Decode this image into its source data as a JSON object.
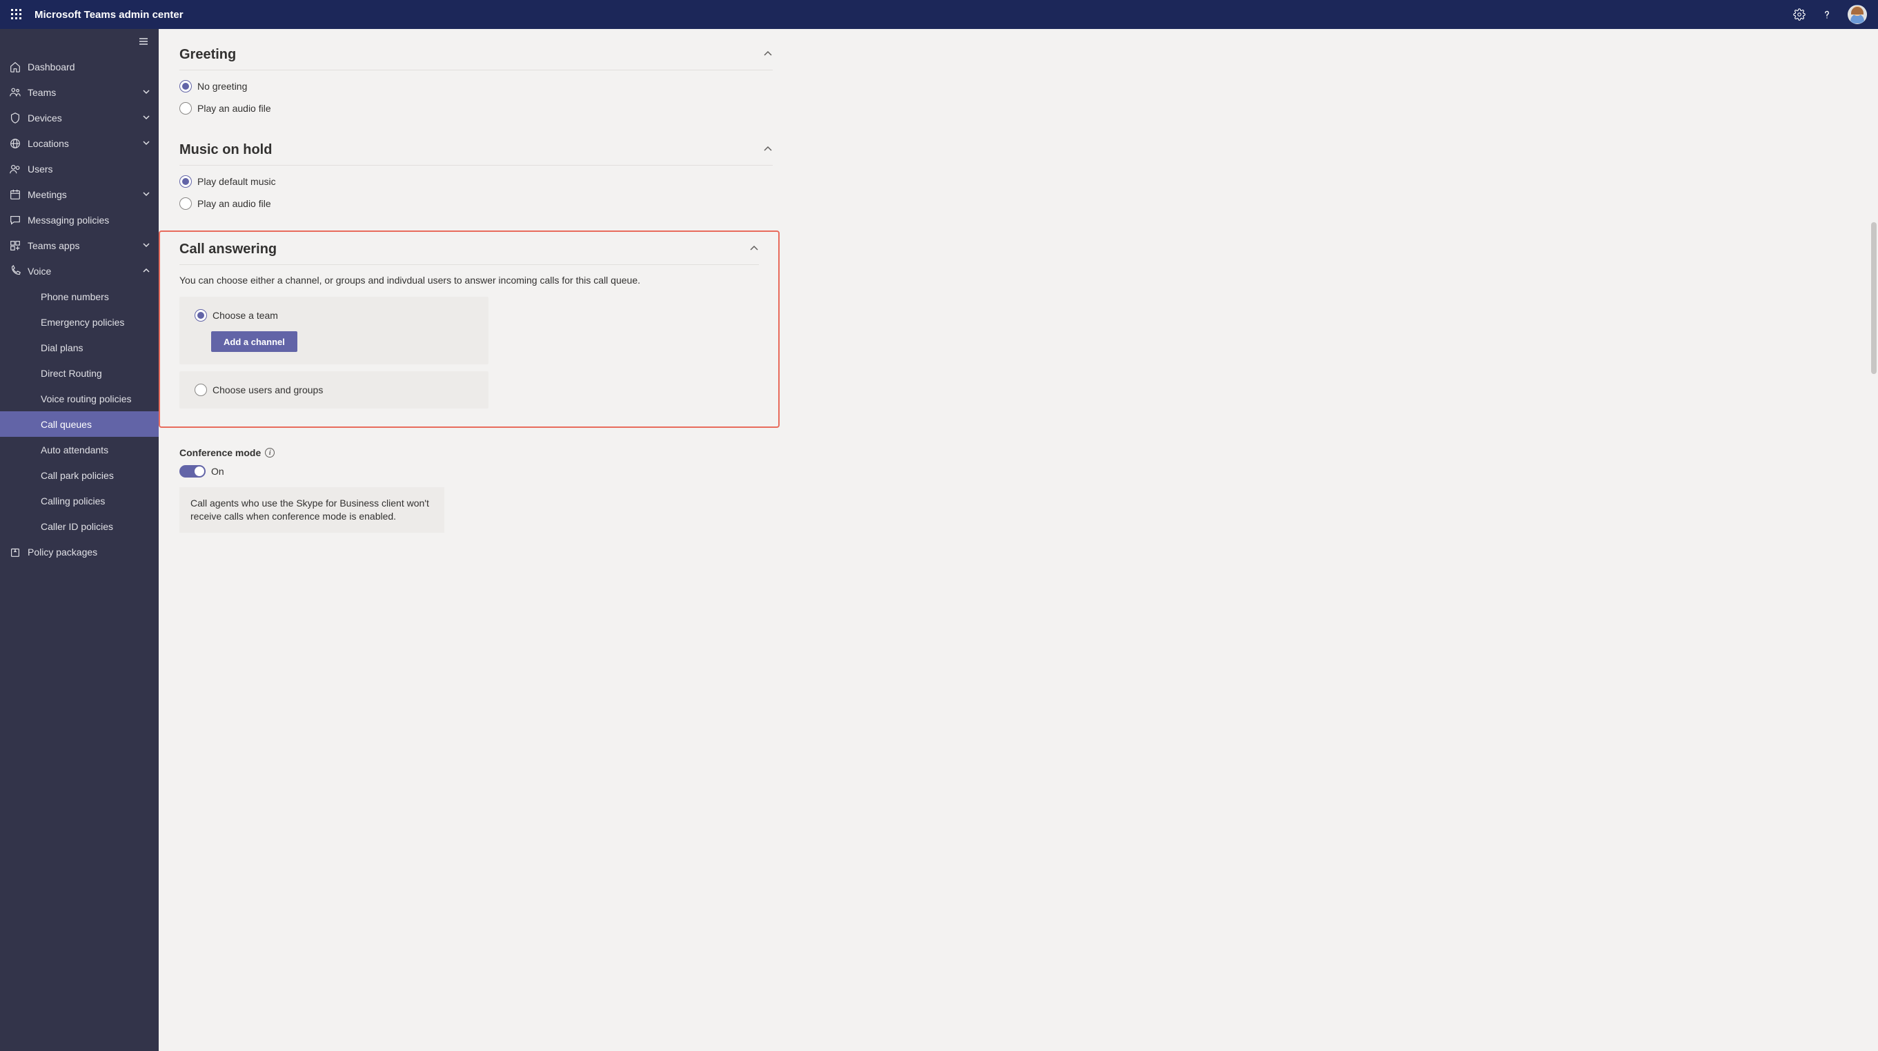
{
  "topbar": {
    "title": "Microsoft Teams admin center"
  },
  "sidebar": {
    "items": [
      {
        "label": "Dashboard",
        "icon": "home",
        "expandable": false
      },
      {
        "label": "Teams",
        "icon": "teams",
        "expandable": true
      },
      {
        "label": "Devices",
        "icon": "devices",
        "expandable": true
      },
      {
        "label": "Locations",
        "icon": "globe",
        "expandable": true
      },
      {
        "label": "Users",
        "icon": "users",
        "expandable": false
      },
      {
        "label": "Meetings",
        "icon": "calendar",
        "expandable": true
      },
      {
        "label": "Messaging policies",
        "icon": "chat",
        "expandable": false
      },
      {
        "label": "Teams apps",
        "icon": "apps",
        "expandable": true
      },
      {
        "label": "Voice",
        "icon": "phone",
        "expandable": true,
        "expanded": true
      },
      {
        "label": "Policy packages",
        "icon": "package",
        "expandable": false
      }
    ],
    "voice_sub": [
      "Phone numbers",
      "Emergency policies",
      "Dial plans",
      "Direct Routing",
      "Voice routing policies",
      "Call queues",
      "Auto attendants",
      "Call park policies",
      "Calling policies",
      "Caller ID policies"
    ],
    "voice_active": "Call queues"
  },
  "sections": {
    "greeting": {
      "title": "Greeting",
      "options": [
        "No greeting",
        "Play an audio file"
      ],
      "selected": 0
    },
    "music": {
      "title": "Music on hold",
      "options": [
        "Play default music",
        "Play an audio file"
      ],
      "selected": 0
    },
    "call_answer": {
      "title": "Call answering",
      "desc": "You can choose either a channel, or groups and indivdual users to answer incoming calls for this call queue.",
      "opt_team": "Choose a team",
      "add_channel_btn": "Add a channel",
      "opt_users": "Choose users and groups",
      "selected": "team"
    },
    "conference": {
      "label": "Conference mode",
      "value_label": "On",
      "note": "Call agents who use the Skype for Business client won't receive calls when conference mode is enabled."
    }
  }
}
